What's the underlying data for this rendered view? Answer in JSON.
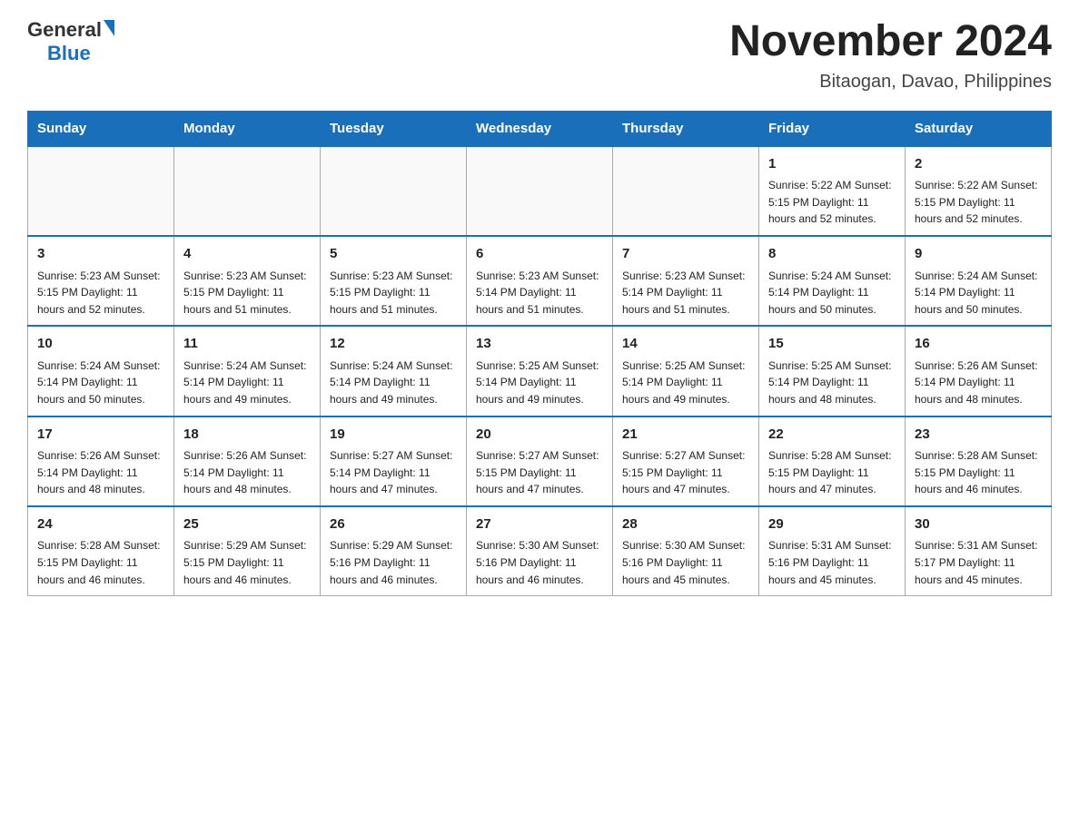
{
  "header": {
    "logo_general": "General",
    "logo_blue": "Blue",
    "month_title": "November 2024",
    "location": "Bitaogan, Davao, Philippines"
  },
  "weekdays": [
    "Sunday",
    "Monday",
    "Tuesday",
    "Wednesday",
    "Thursday",
    "Friday",
    "Saturday"
  ],
  "weeks": [
    [
      {
        "day": "",
        "info": ""
      },
      {
        "day": "",
        "info": ""
      },
      {
        "day": "",
        "info": ""
      },
      {
        "day": "",
        "info": ""
      },
      {
        "day": "",
        "info": ""
      },
      {
        "day": "1",
        "info": "Sunrise: 5:22 AM\nSunset: 5:15 PM\nDaylight: 11 hours and 52 minutes."
      },
      {
        "day": "2",
        "info": "Sunrise: 5:22 AM\nSunset: 5:15 PM\nDaylight: 11 hours and 52 minutes."
      }
    ],
    [
      {
        "day": "3",
        "info": "Sunrise: 5:23 AM\nSunset: 5:15 PM\nDaylight: 11 hours and 52 minutes."
      },
      {
        "day": "4",
        "info": "Sunrise: 5:23 AM\nSunset: 5:15 PM\nDaylight: 11 hours and 51 minutes."
      },
      {
        "day": "5",
        "info": "Sunrise: 5:23 AM\nSunset: 5:15 PM\nDaylight: 11 hours and 51 minutes."
      },
      {
        "day": "6",
        "info": "Sunrise: 5:23 AM\nSunset: 5:14 PM\nDaylight: 11 hours and 51 minutes."
      },
      {
        "day": "7",
        "info": "Sunrise: 5:23 AM\nSunset: 5:14 PM\nDaylight: 11 hours and 51 minutes."
      },
      {
        "day": "8",
        "info": "Sunrise: 5:24 AM\nSunset: 5:14 PM\nDaylight: 11 hours and 50 minutes."
      },
      {
        "day": "9",
        "info": "Sunrise: 5:24 AM\nSunset: 5:14 PM\nDaylight: 11 hours and 50 minutes."
      }
    ],
    [
      {
        "day": "10",
        "info": "Sunrise: 5:24 AM\nSunset: 5:14 PM\nDaylight: 11 hours and 50 minutes."
      },
      {
        "day": "11",
        "info": "Sunrise: 5:24 AM\nSunset: 5:14 PM\nDaylight: 11 hours and 49 minutes."
      },
      {
        "day": "12",
        "info": "Sunrise: 5:24 AM\nSunset: 5:14 PM\nDaylight: 11 hours and 49 minutes."
      },
      {
        "day": "13",
        "info": "Sunrise: 5:25 AM\nSunset: 5:14 PM\nDaylight: 11 hours and 49 minutes."
      },
      {
        "day": "14",
        "info": "Sunrise: 5:25 AM\nSunset: 5:14 PM\nDaylight: 11 hours and 49 minutes."
      },
      {
        "day": "15",
        "info": "Sunrise: 5:25 AM\nSunset: 5:14 PM\nDaylight: 11 hours and 48 minutes."
      },
      {
        "day": "16",
        "info": "Sunrise: 5:26 AM\nSunset: 5:14 PM\nDaylight: 11 hours and 48 minutes."
      }
    ],
    [
      {
        "day": "17",
        "info": "Sunrise: 5:26 AM\nSunset: 5:14 PM\nDaylight: 11 hours and 48 minutes."
      },
      {
        "day": "18",
        "info": "Sunrise: 5:26 AM\nSunset: 5:14 PM\nDaylight: 11 hours and 48 minutes."
      },
      {
        "day": "19",
        "info": "Sunrise: 5:27 AM\nSunset: 5:14 PM\nDaylight: 11 hours and 47 minutes."
      },
      {
        "day": "20",
        "info": "Sunrise: 5:27 AM\nSunset: 5:15 PM\nDaylight: 11 hours and 47 minutes."
      },
      {
        "day": "21",
        "info": "Sunrise: 5:27 AM\nSunset: 5:15 PM\nDaylight: 11 hours and 47 minutes."
      },
      {
        "day": "22",
        "info": "Sunrise: 5:28 AM\nSunset: 5:15 PM\nDaylight: 11 hours and 47 minutes."
      },
      {
        "day": "23",
        "info": "Sunrise: 5:28 AM\nSunset: 5:15 PM\nDaylight: 11 hours and 46 minutes."
      }
    ],
    [
      {
        "day": "24",
        "info": "Sunrise: 5:28 AM\nSunset: 5:15 PM\nDaylight: 11 hours and 46 minutes."
      },
      {
        "day": "25",
        "info": "Sunrise: 5:29 AM\nSunset: 5:15 PM\nDaylight: 11 hours and 46 minutes."
      },
      {
        "day": "26",
        "info": "Sunrise: 5:29 AM\nSunset: 5:16 PM\nDaylight: 11 hours and 46 minutes."
      },
      {
        "day": "27",
        "info": "Sunrise: 5:30 AM\nSunset: 5:16 PM\nDaylight: 11 hours and 46 minutes."
      },
      {
        "day": "28",
        "info": "Sunrise: 5:30 AM\nSunset: 5:16 PM\nDaylight: 11 hours and 45 minutes."
      },
      {
        "day": "29",
        "info": "Sunrise: 5:31 AM\nSunset: 5:16 PM\nDaylight: 11 hours and 45 minutes."
      },
      {
        "day": "30",
        "info": "Sunrise: 5:31 AM\nSunset: 5:17 PM\nDaylight: 11 hours and 45 minutes."
      }
    ]
  ]
}
